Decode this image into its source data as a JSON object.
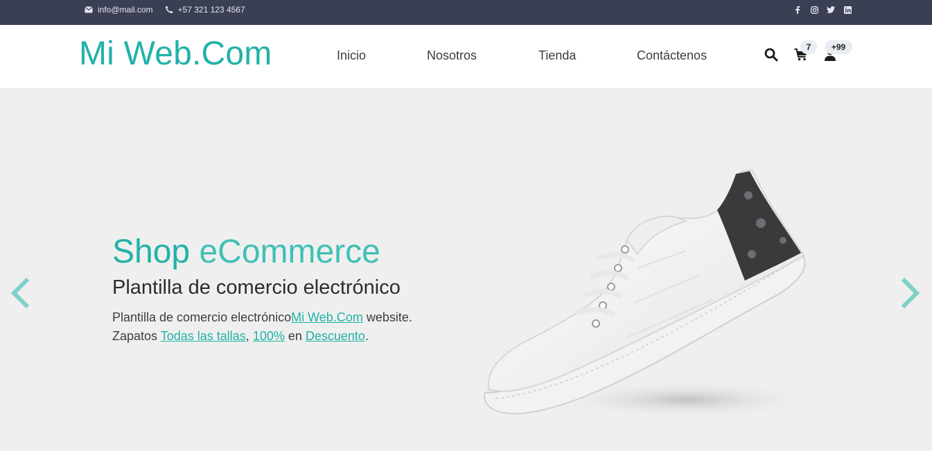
{
  "topbar": {
    "email": "info@mail.com",
    "phone": "+57 321 123 4567",
    "social": [
      "facebook-icon",
      "instagram-icon",
      "twitter-icon",
      "linkedin-icon"
    ]
  },
  "header": {
    "logo": "Mi Web.Com",
    "nav": [
      "Inicio",
      "Nosotros",
      "Tienda",
      "Contáctenos"
    ],
    "cart_count": "7",
    "user_count": "+99"
  },
  "hero": {
    "title_part1": "Shop",
    "title_part2": "eCommerce",
    "subtitle": "Plantilla de comercio electrónico",
    "desc_line1_text": "Plantilla de comercio electrónico",
    "desc_line1_link": "Mi Web.Com",
    "desc_line1_end": " website.",
    "desc_line2_start": "Zapatos ",
    "desc_line2_link1": "Todas las tallas",
    "desc_line2_sep": ", ",
    "desc_line2_link2": "100%",
    "desc_line2_mid": " en ",
    "desc_line2_link3": "Descuento",
    "desc_line2_end": "."
  },
  "colors": {
    "brand": "#21b2a6",
    "topbar": "#3b3f54",
    "hero_bg": "#efefef"
  }
}
